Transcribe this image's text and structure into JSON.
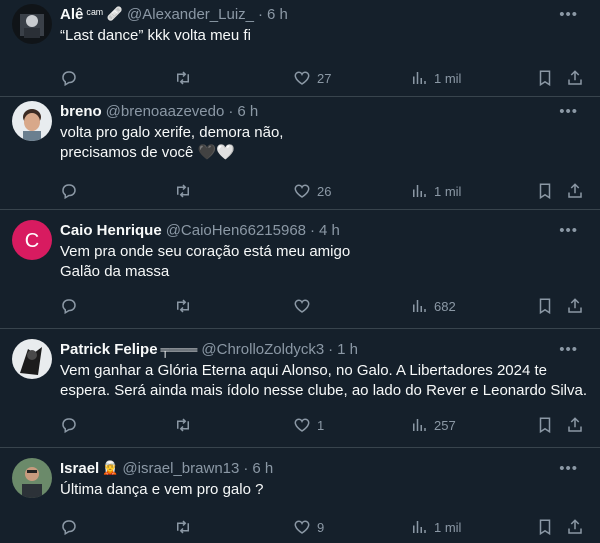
{
  "tweets": [
    {
      "name": "Alê",
      "badge": "ᶜᵃᵐ 🩹",
      "handle": "@Alexander_Luiz_",
      "time": "6 h",
      "lines": [
        "“Last dance” kkk volta meu fi"
      ],
      "likes": "27",
      "views": "1 mil"
    },
    {
      "name": "breno",
      "badge": "",
      "handle": "@brenoaazevedo",
      "time": "6 h",
      "lines": [
        "volta pro galo xerife, demora não,",
        "precisamos de você 🖤🤍"
      ],
      "likes": "26",
      "views": "1 mil"
    },
    {
      "name": "Caio Henrique",
      "badge": "",
      "handle": "@CaioHen66215968",
      "time": "4 h",
      "avatar_letter": "C",
      "lines": [
        "Vem pra onde seu coração está meu amigo",
        "Galão da massa"
      ],
      "likes": "",
      "views": "682"
    },
    {
      "name": "Patrick Felipe",
      "badge": "╤═══",
      "handle": "@ChrolloZoldyck3",
      "time": "1 h",
      "lines": [
        "Vem ganhar a Glória Eterna aqui Alonso, no Galo. A Libertadores 2024 te",
        "espera. Será ainda mais ídolo nesse clube, ao lado do Rever e Leonardo Silva."
      ],
      "likes": "1",
      "views": "257"
    },
    {
      "name": "Israel",
      "badge": "🧝",
      "handle": "@israel_brawn13",
      "time": "6 h",
      "lines": [
        "Última dança e vem pro galo ?"
      ],
      "likes": "9",
      "views": "1 mil"
    }
  ],
  "icons": {
    "more": "more-icon",
    "reply": "reply-icon",
    "retweet": "retweet-icon",
    "like": "heart-icon",
    "views": "views-icon",
    "bookmark": "bookmark-icon",
    "share": "share-icon"
  },
  "colors": {
    "background": "#15202b",
    "muted": "#8b98a5",
    "divider": "#38444d",
    "caio_avatar": "#d81b60"
  }
}
